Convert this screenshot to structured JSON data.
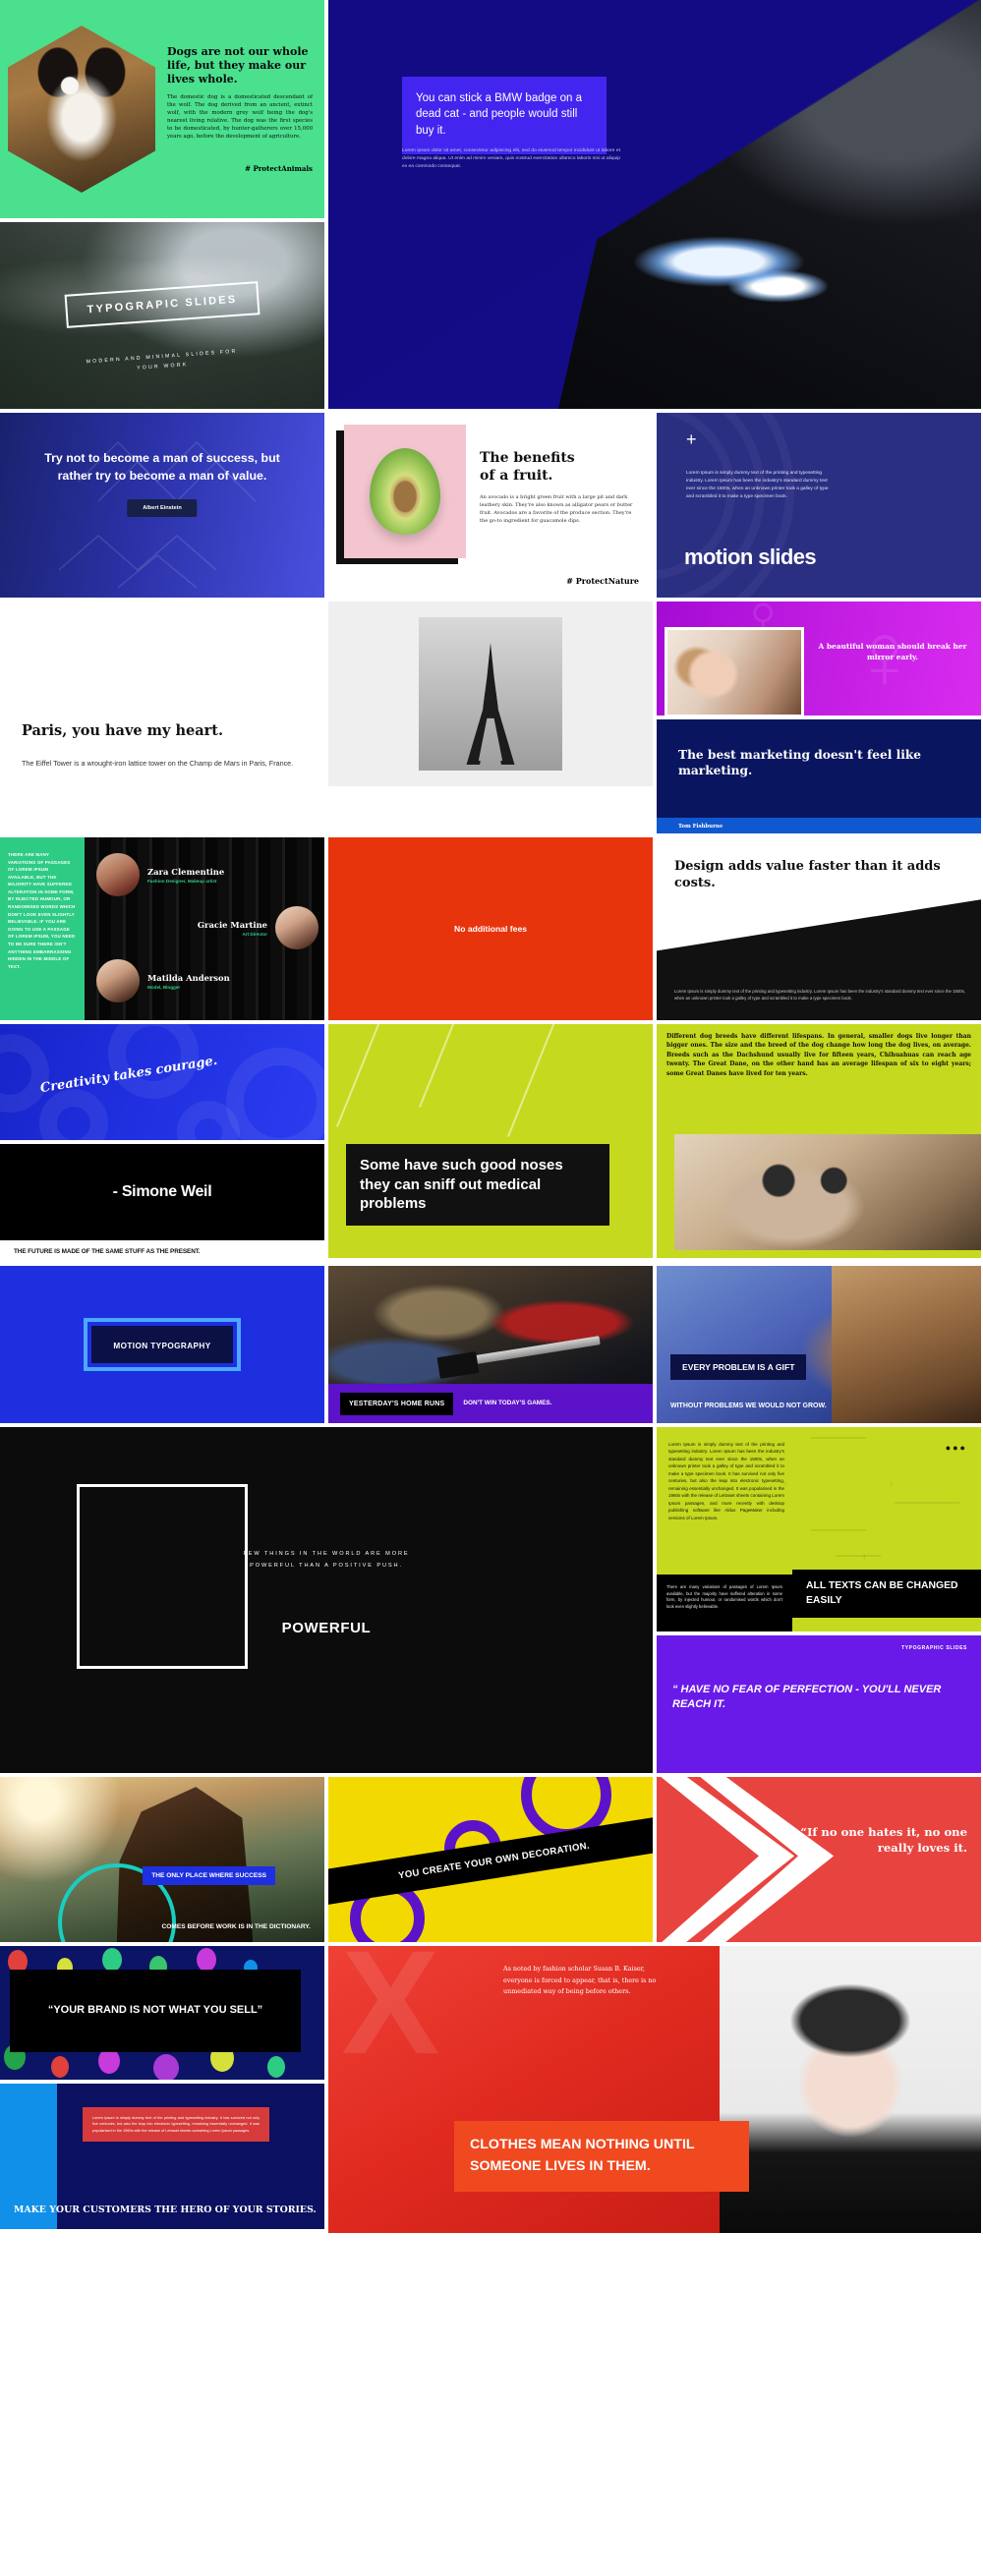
{
  "slides": {
    "dogs": {
      "heading": "Dogs are not our whole life, but they make our lives whole.",
      "body": "The domestic dog is a domesticated descendant of the wolf. The dog derived from an ancient, extinct wolf, with the modern grey wolf being the dog's nearest living relative. The dog was the first species to be domesticated, by hunter-gatherers over 15,000 years ago, before the development of agriculture.",
      "hashtag": "# ProtectAnimals"
    },
    "typographic": {
      "title": "TYPOGRAPIC SLIDES",
      "subtitle": "MODERN AND MINIMAL SLIDES FOR YOUR WORK"
    },
    "bmw": {
      "quote": "You can stick a BMW badge on a dead cat - and people would still buy it.",
      "body": "Lorem ipsum dolor sit amet, consectetur adipiscing elit, sed do eiusmod tempor incididunt ut labore et dolore magna aliqua. Ut enim ad minim veniam, quis nostrud exercitation ullamco laboris nisi ut aliquip ex ea commodo consequat."
    },
    "einstein": {
      "quote": "Try not to become a man of success, but rather try to become a man of value.",
      "author": "Albert Einstein"
    },
    "avocado": {
      "heading_line1": "The benefits",
      "heading_line2": "of a fruit.",
      "body": "An avocado is a bright green fruit with a large pit and dark leathery skin. They're also known as alligator pears or butter fruit. Avocados are a favorite of the produce section. They're the go-to ingredient for guacamole dips.",
      "hashtag": "# ProtectNature"
    },
    "motion": {
      "plus": "+",
      "body": "Lorem Ipsum is simply dummy text of the printing and typesetting industry. Lorem Ipsum has been the industry's standard dummy text ever since the 1500s, when an unknown printer took a galley of type and scrambled it to make a type specimen book.",
      "heading": "motion slides"
    },
    "paris": {
      "heading": "Paris, you have my heart.",
      "body": "The Eiffel Tower is a wrought-iron lattice tower on the Champ de Mars in Paris, France."
    },
    "woman": {
      "quote": "A beautiful woman should break her mirror early."
    },
    "marketing": {
      "quote": "The best marketing doesn't feel like marketing.",
      "author": "Tom Fishburne"
    },
    "team": {
      "sidebar": "THERE ARE MANY VARIATIONS OF PASSAGES OF LOREM IPSUM AVAILABLE, BUT THE MAJORITY HAVE SUFFERED ALTERATION IN SOME FORM, BY INJECTED HUMOUR, OR RANDOMISED WORDS WHICH DON'T LOOK EVEN SLIGHTLY BELIEVABLE. IF YOU ARE GOING TO USE A PASSAGE OF LOREM IPSUM, YOU NEED TO BE SURE THERE ISN'T ANYTHING EMBARRASSING HIDDEN IN THE MIDDLE OF TEXT.",
      "members": [
        {
          "name": "Zara Clementine",
          "role": "Fashion Designer, Makeup artist"
        },
        {
          "name": "Gracie Martine",
          "role": "Art Director"
        },
        {
          "name": "Matilda Anderson",
          "role": "Model, Blogger"
        }
      ]
    },
    "fees": {
      "text": "No additional fees"
    },
    "design": {
      "heading": "Design adds value faster than it adds costs.",
      "body": "Lorem Ipsum is simply dummy text of the printing and typesetting industry. Lorem Ipsum has been the industry's standard dummy text ever since the 1500s, when an unknown printer took a galley of type and scrambled it to make a type specimen book."
    },
    "creativity": {
      "quote": "Creativity takes courage.",
      "author": "- Simone Weil",
      "footer": "THE FUTURE IS MADE OF THE SAME STUFF AS THE PRESENT."
    },
    "noses": {
      "text": "Some have such good noses they can sniff out medical problems"
    },
    "lifespans": {
      "body": "Different dog breeds have different lifespans. In general, smaller dogs live longer than bigger ones. The size and the breed of the dog change how long the dog lives, on average. Breeds such as the Dachshund usually live for fifteen years, Chihuahuas can reach age twenty. The Great Dane, on the other hand has an average lifespan of six to eight years; some Great Danes have lived for ten years."
    },
    "motion_typography": {
      "label": "MOTION TYPOGRAPHY"
    },
    "vinyl": {
      "keyline": "YESTERDAY'S HOME RUNS",
      "subline": "DON'T WIN TODAY'S GAMES."
    },
    "problem": {
      "keyline": "EVERY PROBLEM IS A GIFT",
      "subline": "WITHOUT PROBLEMS WE WOULD NOT GROW."
    },
    "powerful": {
      "quote": "FEW THINGS IN THE WORLD ARE MORE POWERFUL THAN A POSITIVE PUSH.",
      "word": "POWERFUL"
    },
    "alltexts": {
      "body": "Lorem Ipsum is simply dummy text of the printing and typesetting industry. Lorem Ipsum has been the industry's standard dummy text ever since the 1500s, when an unknown printer took a galley of type and scrambled it to make a type specimen book. It has survived not only five centuries, but also the leap into electronic typesetting, remaining essentially unchanged. It was popularised in the 1960s with the release of Letraset sheets containing Lorem Ipsum passages, and more recently with desktop publishing software like Aldus PageMaker including versions of Lorem Ipsum.",
      "black_body": "There are many variations of passages of Lorem Ipsum available, but the majority have suffered alteration in some form, by injected humour, or randomised words which don't look even slightly believable.",
      "keyline": "ALL TEXTS CAN BE CHANGED EASILY",
      "dots": "●●●"
    },
    "perfection": {
      "tag": "TYPOGRAPHIC SLIDES",
      "quote": "“ HAVE NO FEAR OF PERFECTION - YOU'LL NEVER REACH IT."
    },
    "photographer": {
      "keyline": "THE ONLY PLACE WHERE SUCCESS",
      "subline": "COMES BEFORE WORK IS IN THE DICTIONARY."
    },
    "decoration": {
      "text": "YOU CREATE YOUR OWN DECORATION."
    },
    "hates": {
      "quote": "“If no one hates it, no one really loves it."
    },
    "brand": {
      "quote": "“YOUR BRAND IS NOT WHAT YOU SELL”"
    },
    "customers": {
      "body": "Lorem Ipsum is simply dummy text of the printing and typesetting industry. It has survived not only five centuries, but also the leap into electronic typesetting, remaining essentially unchanged. It was popularised in the 1960s with the release of Letraset sheets containing Lorem Ipsum passages.",
      "heading": "MAKE YOUR CUSTOMERS THE HERO OF YOUR STORIES."
    },
    "clothes": {
      "body": "As noted by fashion scholar Susan B. Kaiser, everyone is forced to appear, that is, there is no unmediated way of being before others.",
      "keyline": "CLOTHES MEAN NOTHING UNTIL SOMEONE LIVES IN THEM.",
      "watermark": "X"
    }
  },
  "colors": {
    "green": "#4ae08e",
    "navy": "#130c86",
    "violet": "#4325f0",
    "magenta": "#c21de2",
    "lime": "#c5da1e",
    "red": "#e8340c",
    "yellow": "#f2da00",
    "purple": "#6a1ae8",
    "orange": "#f0491f",
    "blue": "#1e2fe0"
  }
}
